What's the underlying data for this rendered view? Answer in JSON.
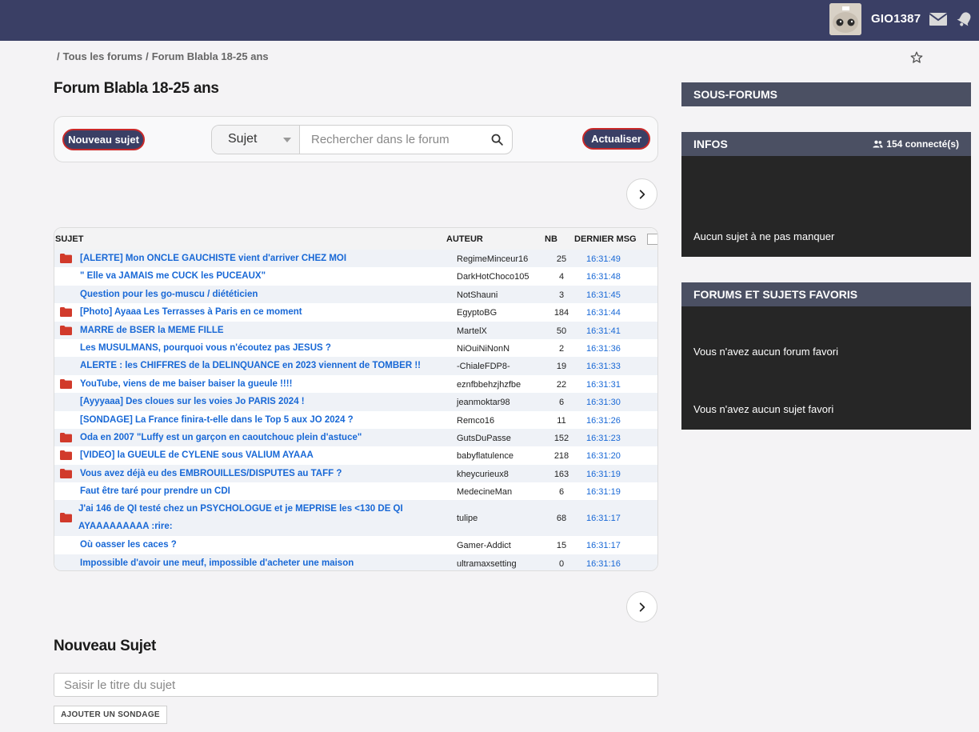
{
  "header": {
    "username": "GIO1387",
    "mail_icon": "mail-icon",
    "bell_icon": "bell-icon"
  },
  "breadcrumb": {
    "separator": "/",
    "items": [
      "Tous les forums",
      "Forum Blabla 18-25 ans"
    ]
  },
  "page": {
    "title": "Forum Blabla 18-25 ans"
  },
  "toolbar": {
    "new_topic_label": "Nouveau sujet",
    "search_mode": "Sujet",
    "search_placeholder": "Rechercher dans le forum",
    "refresh_label": "Actualiser"
  },
  "table": {
    "headers": {
      "subject": "SUJET",
      "author": "AUTEUR",
      "count": "NB",
      "last": "DERNIER MSG"
    },
    "rows": [
      {
        "title": "[ALERTE] Mon ONCLE GAUCHISTE vient d'arriver CHEZ MOI",
        "author": "RegimeMinceur16",
        "nb": "25",
        "time": "16:31:49",
        "hot": true
      },
      {
        "title": "\" Elle va JAMAIS me CUCK les PUCEAUX\"",
        "author": "DarkHotChoco105",
        "nb": "4",
        "time": "16:31:48",
        "hot": false
      },
      {
        "title": "Question pour les go-muscu / diététicien",
        "author": "NotShauni",
        "nb": "3",
        "time": "16:31:45",
        "hot": false
      },
      {
        "title": "[Photo] Ayaaa Les Terrasses à Paris en ce moment",
        "author": "EgyptoBG",
        "nb": "184",
        "time": "16:31:44",
        "hot": true
      },
      {
        "title": "MARRE de BSER la MEME FILLE",
        "author": "MartelX",
        "nb": "50",
        "time": "16:31:41",
        "hot": true
      },
      {
        "title": "Les MUSULMANS, pourquoi vous n'écoutez pas JESUS ?",
        "author": "NiOuiNiNonN",
        "nb": "2",
        "time": "16:31:36",
        "hot": false
      },
      {
        "title": "ALERTE : les CHIFFRES de la DELINQUANCE en 2023 viennent de TOMBER !!",
        "author": "-ChialeFDP8-",
        "nb": "19",
        "time": "16:31:33",
        "hot": false
      },
      {
        "title": "YouTube, viens de me baiser baiser la gueule !!!!",
        "author": "eznfbbehzjhzfbe",
        "nb": "22",
        "time": "16:31:31",
        "hot": true
      },
      {
        "title": "[Ayyyaaa] Des cloues sur les voies Jo PARIS 2024 !",
        "author": "jeanmoktar98",
        "nb": "6",
        "time": "16:31:30",
        "hot": false
      },
      {
        "title": "[SONDAGE] La France finira-t-elle dans le Top 5 aux JO 2024 ?",
        "author": "Remco16",
        "nb": "11",
        "time": "16:31:26",
        "hot": false
      },
      {
        "title": "Oda en 2007 \"Luffy est un garçon en caoutchouc plein d'astuce\"",
        "author": "GutsDuPasse",
        "nb": "152",
        "time": "16:31:23",
        "hot": true
      },
      {
        "title": "[VIDEO] la GUEULE de CYLENE sous VALIUM AYAAA",
        "author": "babyflatulence",
        "nb": "218",
        "time": "16:31:20",
        "hot": true
      },
      {
        "title": "Vous avez déjà eu des EMBROUILLES/DISPUTES au TAFF ?",
        "author": "kheycurieux8",
        "nb": "163",
        "time": "16:31:19",
        "hot": true
      },
      {
        "title": "Faut être taré pour prendre un CDI",
        "author": "MedecineMan",
        "nb": "6",
        "time": "16:31:19",
        "hot": false
      },
      {
        "title": "J'ai 146 de QI testé chez un PSYCHOLOGUE et je MEPRISE les <130 DE QI AYAAAAAAAAA :rire:",
        "author": "tulipe",
        "nb": "68",
        "time": "16:31:17",
        "hot": true,
        "tall": true
      },
      {
        "title": "Où oasser les caces ?",
        "author": "Gamer-Addict",
        "nb": "15",
        "time": "16:31:17",
        "hot": false
      },
      {
        "title": "Impossible d'avoir une meuf, impossible d'acheter une maison",
        "author": "ultramaxsetting",
        "nb": "0",
        "time": "16:31:16",
        "hot": false
      }
    ]
  },
  "new_topic": {
    "heading": "Nouveau Sujet",
    "title_placeholder": "Saisir le titre du sujet",
    "poll_button": "AJOUTER UN SONDAGE"
  },
  "sidebar": {
    "subforums_title": "SOUS-FORUMS",
    "infos_title": "INFOS",
    "connected": "154 connecté(s)",
    "infos_text": "Aucun sujet à ne pas manquer",
    "favorites_title": "FORUMS ET SUJETS FAVORIS",
    "no_fav_forum": "Vous n'avez aucun forum favori",
    "no_fav_topic": "Vous n'avez aucun sujet favori"
  },
  "colors": {
    "header_bg": "#3a3f65",
    "link": "#1868d6",
    "folder": "#d13a2b",
    "button_border": "#c92929",
    "sidebar_dark": "#262626",
    "sidebar_header": "#4b5063"
  }
}
